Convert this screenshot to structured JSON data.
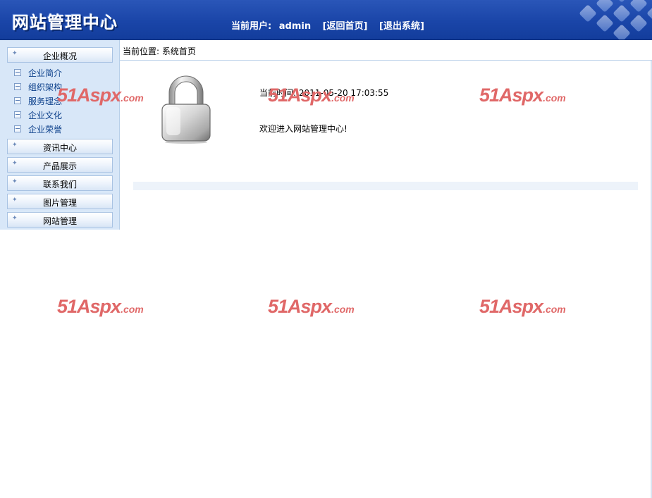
{
  "header": {
    "logo": "网站管理中心",
    "user_label": "当前用户:",
    "username": "admin",
    "back_home": "[返回首页]",
    "logout": "[退出系统]"
  },
  "sidebar": {
    "menus": [
      {
        "label": "企业概况",
        "expanded": true
      },
      {
        "label": "资讯中心",
        "expanded": false
      },
      {
        "label": "产品展示",
        "expanded": false
      },
      {
        "label": "联系我们",
        "expanded": false
      },
      {
        "label": "图片管理",
        "expanded": false
      },
      {
        "label": "网站管理",
        "expanded": false
      }
    ],
    "submenu": [
      "企业简介",
      "组织架构",
      "服务理念",
      "企业文化",
      "企业荣誉"
    ]
  },
  "breadcrumb": {
    "label": "当前位置:",
    "page": "系统首页"
  },
  "main": {
    "time_label": "当前时间:",
    "time_value": "2011-05-20 17:03:55",
    "welcome": "欢迎进入网站管理中心!"
  },
  "watermark": {
    "text_big": "51Aspx",
    "text_small": ".com"
  },
  "colors": {
    "header_blue": "#1a45a8",
    "sidebar_bg": "#d8e7f8",
    "link_blue": "#0b3f8a",
    "watermark_red": "#e06868"
  }
}
